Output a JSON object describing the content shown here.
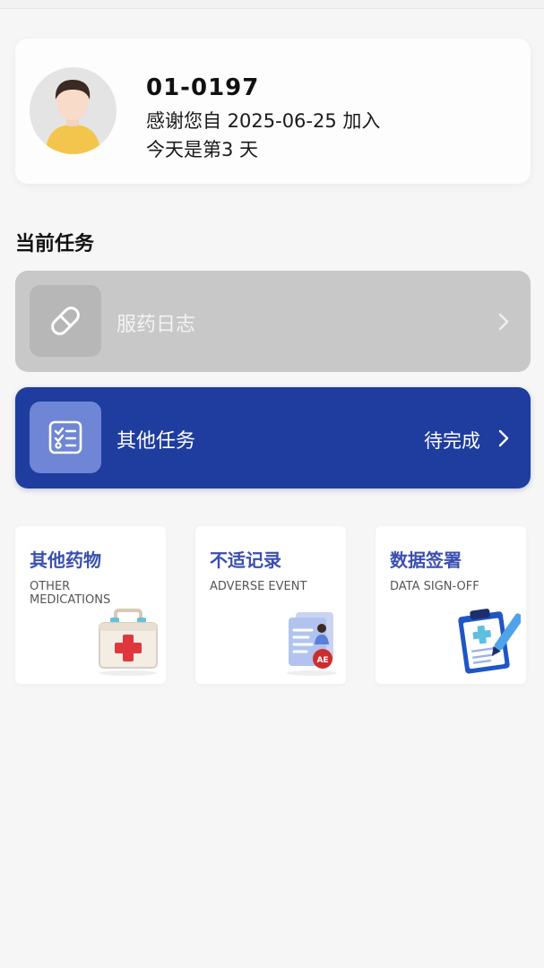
{
  "profile": {
    "participant_id": "01-0197",
    "joined_text": "感谢您自 2025-06-25 加入",
    "day_text": "今天是第3 天"
  },
  "section": {
    "title": "当前任务"
  },
  "tasks": [
    {
      "label": "服药日志",
      "status": "",
      "icon": "pill-icon",
      "state": "disabled",
      "color": "#c8c8c8"
    },
    {
      "label": "其他任务",
      "status": "待完成",
      "icon": "checklist-icon",
      "state": "active",
      "color": "#1f3d9e"
    }
  ],
  "tiles": [
    {
      "title": "其他药物",
      "subtitle": "OTHER MEDICATIONS",
      "icon": "first-aid-kit-icon"
    },
    {
      "title": "不适记录",
      "subtitle": "ADVERSE EVENT",
      "icon": "adverse-event-report-icon"
    },
    {
      "title": "数据签署",
      "subtitle": "DATA SIGN-OFF",
      "icon": "clipboard-sign-icon"
    }
  ],
  "colors": {
    "accent": "#1f3d9e",
    "tile_title": "#3a4fb0",
    "disabled": "#c8c8c8"
  }
}
